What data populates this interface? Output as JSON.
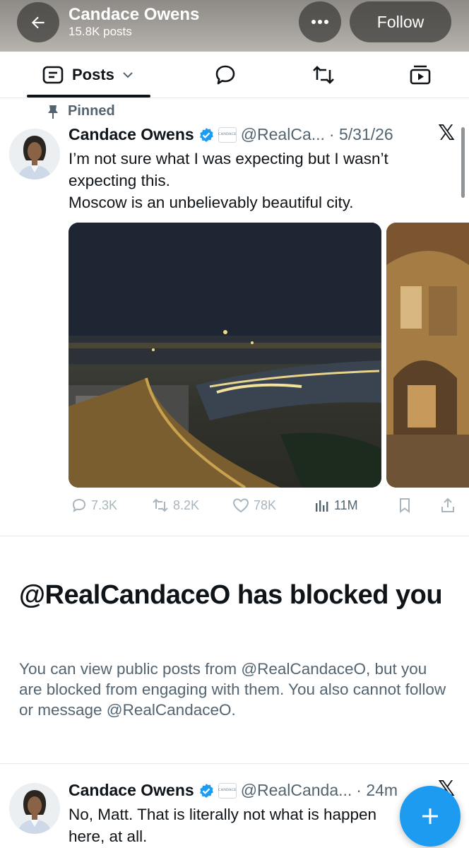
{
  "header": {
    "title": "Candace Owens",
    "subtitle": "15.8K posts",
    "follow_label": "Follow"
  },
  "tabs": {
    "posts_label": "Posts"
  },
  "pinned_tweet": {
    "pinned_label": "Pinned",
    "name": "Candace Owens",
    "badge_text": "CANDACE",
    "handle": "@RealCa...",
    "time": "· 5/31/26",
    "text_lines": [
      "I’m not sure what I was expecting but I wasn’t expecting this.",
      "Moscow is an unbelievably beautiful city."
    ],
    "stats": {
      "replies": "7.3K",
      "reposts": "8.2K",
      "likes": "78K",
      "views": "11M"
    }
  },
  "blocked_notice": {
    "title": "@RealCandaceO has blocked you",
    "body": "You can view public posts from @RealCandaceO, but you are blocked from engaging with them. You also cannot follow or message @RealCandaceO."
  },
  "second_tweet": {
    "name": "Candace Owens",
    "badge_text": "CANDACE",
    "handle": "@RealCanda...",
    "time": "· 24m",
    "text": "No, Matt. That is literally not what is happen here, at all."
  },
  "colors": {
    "accent": "#1d9bf0",
    "text": "#0f1419",
    "muted": "#536471"
  }
}
